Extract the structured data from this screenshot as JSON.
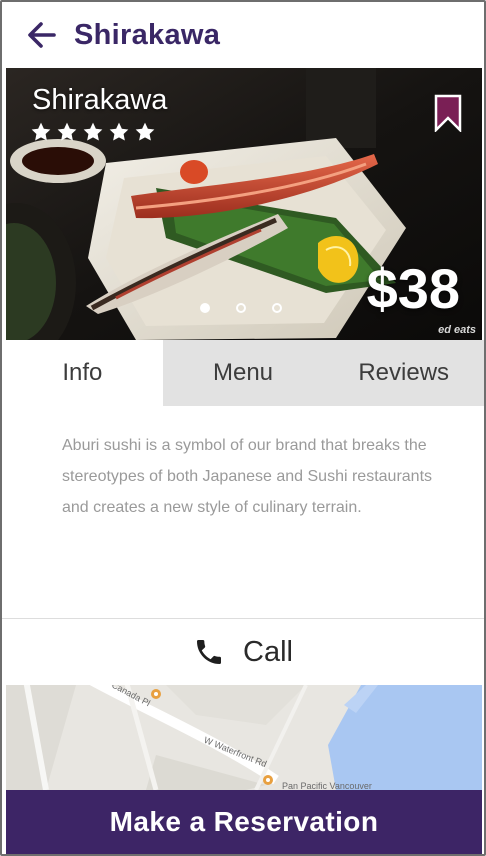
{
  "header": {
    "title": "Shirakawa",
    "back_icon": "arrow-left-icon"
  },
  "hero": {
    "name": "Shirakawa",
    "rating": 5,
    "price": "$38",
    "photo_credit": "ed eats",
    "carousel": {
      "total": 3,
      "active": 1
    }
  },
  "tabs": [
    {
      "label": "Info",
      "active": true
    },
    {
      "label": "Menu",
      "active": false
    },
    {
      "label": "Reviews",
      "active": false
    }
  ],
  "info": {
    "description": "Aburi sushi is a symbol of our brand that breaks the stereotypes of both Japanese and Sushi restaurants and creates a new style of culinary terrain."
  },
  "call": {
    "label": "Call",
    "icon": "phone-icon"
  },
  "map": {
    "labels": [
      "Canada Pl",
      "W Waterfront Rd",
      "Pan Pacific Vancouver"
    ]
  },
  "reservation": {
    "label": "Make a Reservation"
  },
  "colors": {
    "brand": "#3d2566",
    "title_text": "#3a2766",
    "bookmark": "#7a1f55",
    "tab_inactive": "#e2e2e2",
    "water": "#a9c7f2"
  }
}
